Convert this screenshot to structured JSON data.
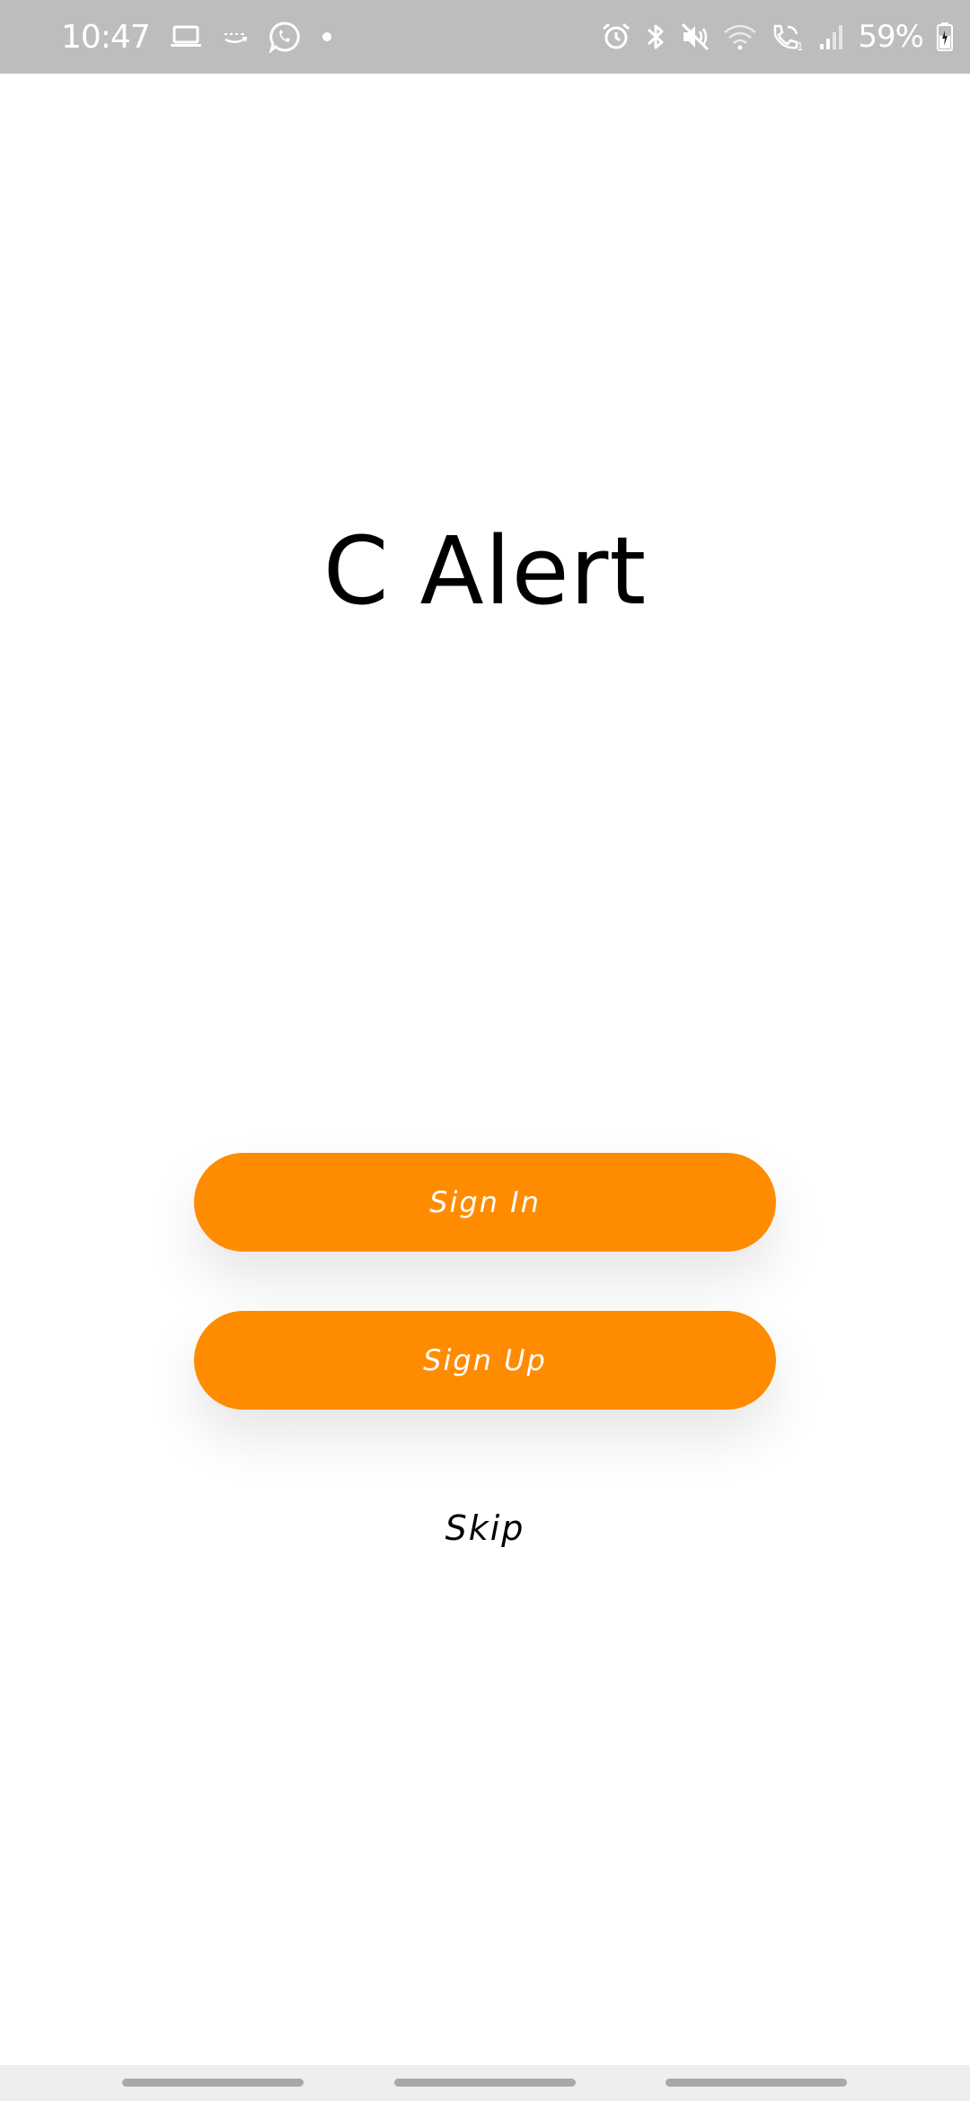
{
  "status_bar": {
    "time": "10:47",
    "battery_percent": "59%",
    "battery_level": 0.59,
    "left_icons": [
      "laptop-icon",
      "amazon-music-icon",
      "whatsapp-icon",
      "dot-icon"
    ],
    "right_icons": [
      "alarm-icon",
      "bluetooth-icon",
      "mute-icon",
      "wifi-icon",
      "wifi-calling-icon",
      "signal-icon",
      "battery-icon"
    ],
    "background_color": "#bdbdbd"
  },
  "app": {
    "title": "C Alert"
  },
  "actions": {
    "sign_in_label": "Sign In",
    "sign_up_label": "Sign Up",
    "skip_label": "Skip"
  },
  "colors": {
    "accent": "#ff8c00",
    "background": "#ffffff",
    "text": "#000000"
  },
  "nav_bar": {
    "type": "gesture-navigation"
  }
}
